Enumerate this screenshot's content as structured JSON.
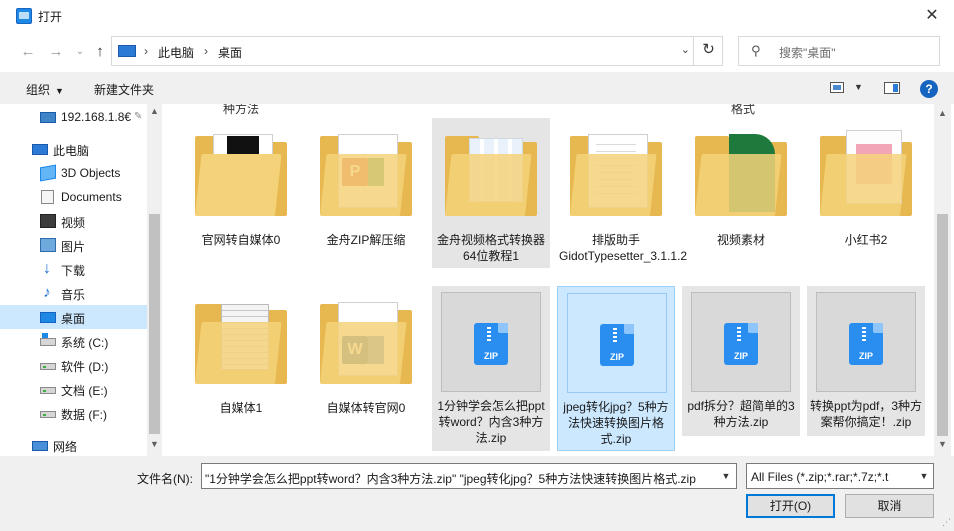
{
  "window": {
    "title": "打开",
    "close_label": "✕"
  },
  "nav": {
    "back": "←",
    "forward": "→",
    "up": "↑",
    "dropdown": "⌄",
    "refresh": "↻"
  },
  "address": {
    "separator": "›",
    "segments": [
      "此电脑",
      "桌面"
    ],
    "dropdown": "⌄"
  },
  "search": {
    "placeholder": "搜索\"桌面\""
  },
  "toolbar": {
    "organize": "组织",
    "new_folder": "新建文件夹",
    "help": "?"
  },
  "sidebar": {
    "items": [
      {
        "label": "192.168.1.8€",
        "icon": "network-computer-icon"
      },
      {
        "label": "此电脑",
        "icon": "pc-icon"
      },
      {
        "label": "3D Objects",
        "icon": "3d-objects-icon"
      },
      {
        "label": "Documents",
        "icon": "documents-icon"
      },
      {
        "label": "视频",
        "icon": "video-icon"
      },
      {
        "label": "图片",
        "icon": "pictures-icon"
      },
      {
        "label": "下载",
        "icon": "download-icon"
      },
      {
        "label": "音乐",
        "icon": "music-icon"
      },
      {
        "label": "桌面",
        "icon": "desktop-icon",
        "selected": true
      },
      {
        "label": "系统 (C:)",
        "icon": "drive-c-icon"
      },
      {
        "label": "软件 (D:)",
        "icon": "drive-icon"
      },
      {
        "label": "文档 (E:)",
        "icon": "drive-icon"
      },
      {
        "label": "数据 (F:)",
        "icon": "drive-icon"
      },
      {
        "label": "网络",
        "icon": "network-icon"
      }
    ]
  },
  "files": {
    "partial_labels": [
      "种方法",
      "格式"
    ],
    "items": [
      {
        "name": "官网转自媒体0",
        "type": "folder"
      },
      {
        "name": "金舟ZIP解压缩",
        "type": "folder"
      },
      {
        "name": "金舟视频格式转换器64位教程1",
        "type": "folder"
      },
      {
        "name": "排版助手GidotTypesetter_3.1.1.2",
        "type": "folder"
      },
      {
        "name": "视频素材",
        "type": "folder"
      },
      {
        "name": "小红书2",
        "type": "folder"
      },
      {
        "name": "自媒体1",
        "type": "folder"
      },
      {
        "name": "自媒体转官网0",
        "type": "folder"
      },
      {
        "name": "1分钟学会怎么把ppt转word？内含3种方法.zip",
        "type": "zip"
      },
      {
        "name": "jpeg转化jpg？5种方法快速转换图片格式.zip",
        "type": "zip"
      },
      {
        "name": "pdf拆分？超简单的3种方法.zip",
        "type": "zip"
      },
      {
        "name": "转换ppt为pdf，3种方案帮你搞定！.zip",
        "type": "zip"
      }
    ],
    "zip_badge": "ZIP",
    "word_letter": "W",
    "ppt_letter": "P"
  },
  "footer": {
    "filename_label": "文件名(N):",
    "filename_value": "\"1分钟学会怎么把ppt转word？内含3种方法.zip\" \"jpeg转化jpg？5种方法快速转换图片格式.zip",
    "filter_value": "All Files (*.zip;*.rar;*.7z;*.t",
    "open_label": "打开(O)",
    "cancel_label": "取消"
  },
  "colors": {
    "accent": "#0078d7",
    "selection": "#cce8ff",
    "folder": "#f4d27a",
    "zip": "#2a8ef0"
  }
}
